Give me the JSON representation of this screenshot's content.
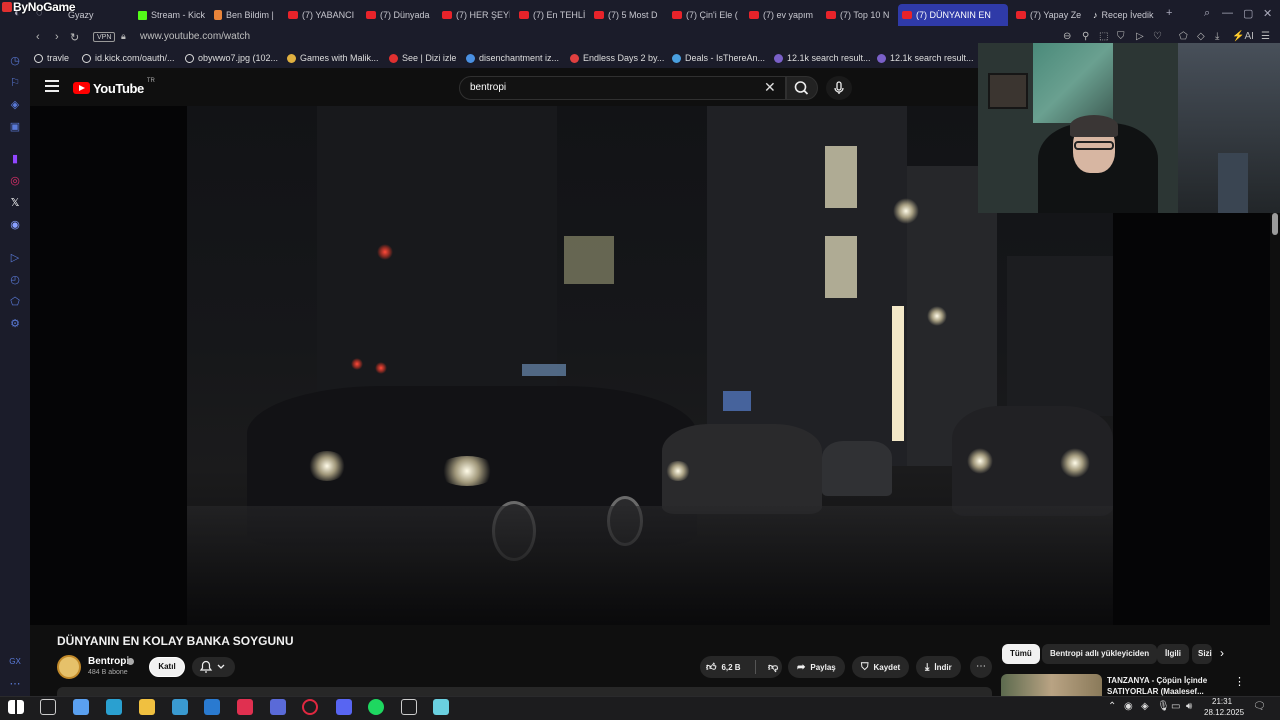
{
  "overlay": {
    "brand": "ByNoGame"
  },
  "browser": {
    "tabs": [
      {
        "label": "Gyazy",
        "icon": "gyazy-icon"
      },
      {
        "label": "Stream - Kick",
        "icon": "kick-icon"
      },
      {
        "label": "Ben Bildim |",
        "icon": "fire-icon"
      },
      {
        "label": "(7) YABANCI",
        "icon": "youtube-icon"
      },
      {
        "label": "(7) Dünyada",
        "icon": "youtube-icon"
      },
      {
        "label": "(7) HER ŞEYİ",
        "icon": "youtube-icon"
      },
      {
        "label": "(7) En TEHLİ",
        "icon": "youtube-icon"
      },
      {
        "label": "(7) 5 Most D",
        "icon": "youtube-icon"
      },
      {
        "label": "(7) Çin'i Ele (",
        "icon": "youtube-icon"
      },
      {
        "label": "(7) ev yapım",
        "icon": "youtube-icon"
      },
      {
        "label": "(7) Top 10 N",
        "icon": "youtube-icon"
      },
      {
        "label": "(7) DÜNYANIN EN",
        "icon": "youtube-icon",
        "active": true
      },
      {
        "label": "(7) Yapay Ze",
        "icon": "youtube-icon"
      },
      {
        "label": "Recep İvedik",
        "icon": "tiktok-icon"
      }
    ],
    "vpn_label": "VPN",
    "url": "www.youtube.com/watch",
    "ai_label": "AI",
    "bookmarks": [
      {
        "label": "travle",
        "icon": "globe-icon",
        "color": "#dddddd"
      },
      {
        "label": "id.kick.com/oauth/...",
        "icon": "doc-icon",
        "color": "#dddddd"
      },
      {
        "label": "obywwo7.jpg (102...",
        "icon": "doc-icon",
        "color": "#dddddd"
      },
      {
        "label": "Games with Malik...",
        "icon": "game-icon",
        "color": "#e0b040"
      },
      {
        "label": "See | Dizi izle",
        "icon": "play-icon",
        "color": "#e03030"
      },
      {
        "label": "disenchantment iz...",
        "icon": "google-icon",
        "color": "#4a90e2"
      },
      {
        "label": "Endless Days 2 by...",
        "icon": "image-icon",
        "color": "#e04040"
      },
      {
        "label": "Deals - IsThereAn...",
        "icon": "tag-icon",
        "color": "#4aa0e0"
      },
      {
        "label": "12.1k search result...",
        "icon": "search-icon",
        "color": "#7a60c8"
      },
      {
        "label": "12.1k search result...",
        "icon": "search-icon",
        "color": "#7a60c8"
      }
    ]
  },
  "youtube": {
    "logo_text": "YouTube",
    "region": "TR",
    "search_value": "bentropi",
    "video": {
      "title": "DÜNYANIN EN KOLAY BANKA SOYGUNU",
      "channel": "Bentropi",
      "subscribers": "484 B abone",
      "join_label": "Katıl",
      "likes": "6,2 B",
      "share_label": "Paylaş",
      "save_label": "Kaydet",
      "download_label": "İndir"
    },
    "chips": [
      "Tümü",
      "Bentropi adlı yükleyiciden",
      "İlgili",
      "Sizin için"
    ],
    "recommendation": {
      "title": "TANZANYA - Çöpün İçinde SATIYORLAR (Maalesef..."
    }
  },
  "taskbar": {
    "apps": [
      "start-icon",
      "task-view-icon",
      "copilot-icon",
      "edge-icon",
      "file-explorer-icon",
      "store-icon",
      "mail-icon",
      "pocket-icon",
      "app-icon",
      "opera-gx-icon",
      "discord-icon",
      "spotify-icon",
      "obs-icon",
      "app-icon"
    ],
    "time": "21:31",
    "date": "28.12.2025"
  },
  "colors": {
    "accent": "#2f3aa8",
    "youtube_red": "#ff0000",
    "background": "#0f0f0f"
  }
}
